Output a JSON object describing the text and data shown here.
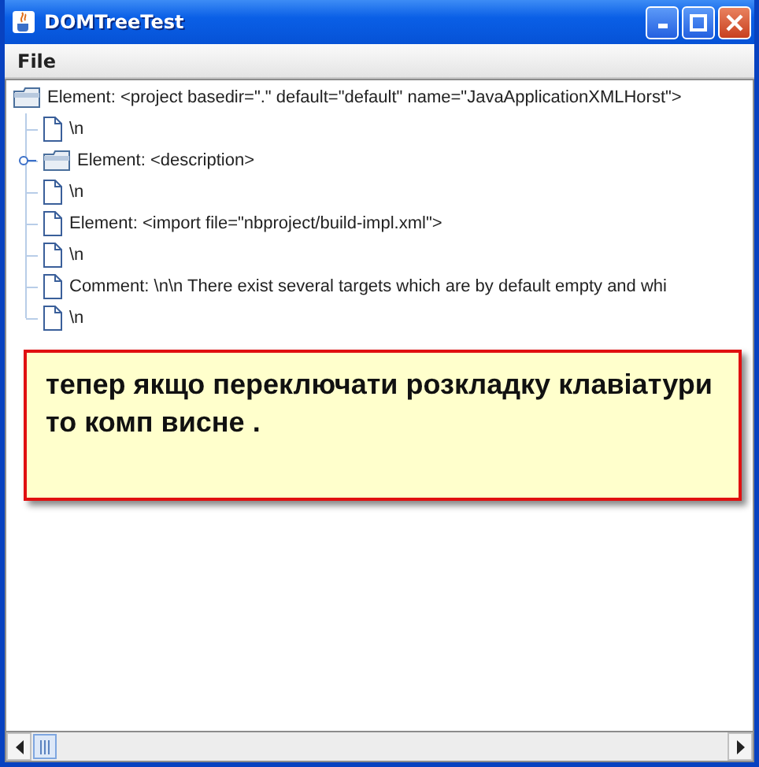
{
  "window": {
    "title": "DOMTreeTest"
  },
  "menu": [
    "File"
  ],
  "tree": {
    "label": "Element: <project basedir=\".\" default=\"default\" name=\"JavaApplicationXMLHorst\">",
    "kind": "folder",
    "children": [
      {
        "label": "\\n",
        "kind": "file"
      },
      {
        "label": "Element: <description>",
        "kind": "folder",
        "expanded": false
      },
      {
        "label": "\\n",
        "kind": "file"
      },
      {
        "label": "Element: <import file=\"nbproject/build-impl.xml\">",
        "kind": "file"
      },
      {
        "label": "\\n",
        "kind": "file"
      },
      {
        "label": "Comment: \\n\\n    There exist several targets which are by default empty and whi",
        "kind": "file"
      },
      {
        "label": "\\n",
        "kind": "file"
      }
    ]
  },
  "note": "тепер якщо переключати розкладку клавіатури то комп висне ."
}
